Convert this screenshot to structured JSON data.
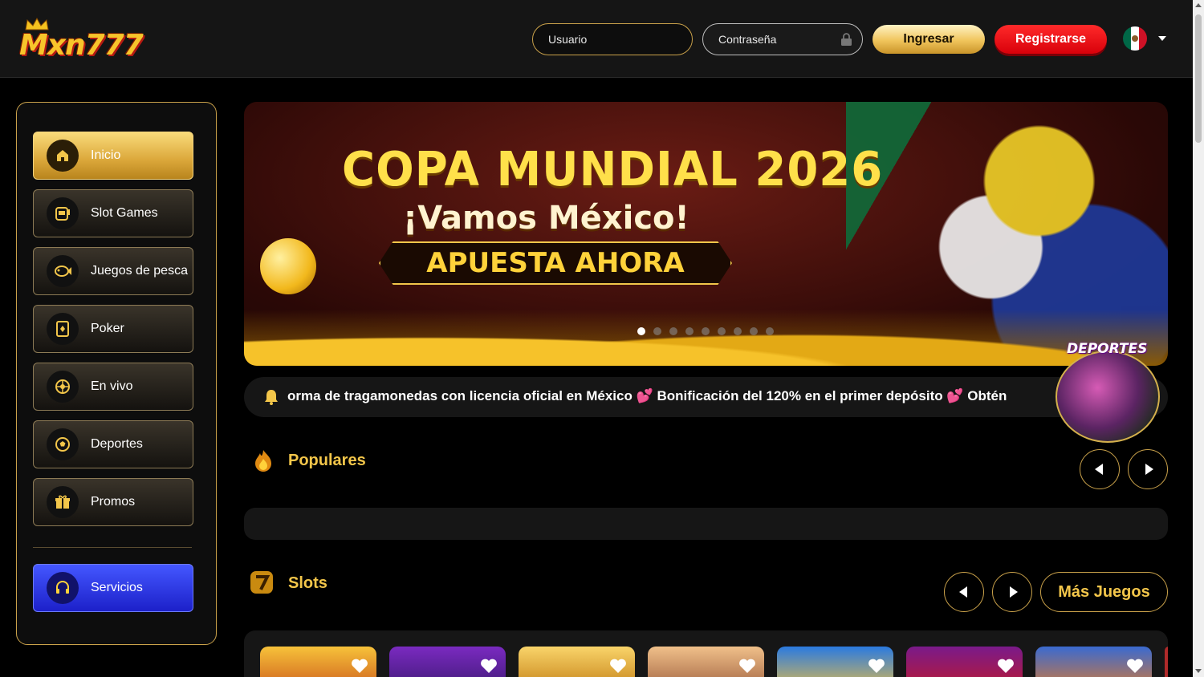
{
  "header": {
    "logo_text": "Mxn777",
    "username_placeholder": "Usuario",
    "password_placeholder": "Contraseña",
    "login_label": "Ingresar",
    "register_label": "Registrarse",
    "language": "mexico-flag-icon"
  },
  "sidebar": {
    "items": [
      {
        "label": "Inicio",
        "icon": "home-icon",
        "active": true
      },
      {
        "label": "Slot Games",
        "icon": "slot-machine-icon"
      },
      {
        "label": "Juegos de pesca",
        "icon": "fish-icon"
      },
      {
        "label": "Poker",
        "icon": "cards-icon"
      },
      {
        "label": "En vivo",
        "icon": "roulette-icon"
      },
      {
        "label": "Deportes",
        "icon": "soccer-ball-icon"
      },
      {
        "label": "Promos",
        "icon": "gift-icon"
      }
    ],
    "service": {
      "label": "Servicios",
      "icon": "headset-icon"
    }
  },
  "banner": {
    "title": "COPA MUNDIAL 2026",
    "subtitle": "¡Vamos México!",
    "cta": "APUESTA AHORA",
    "slide_count": 9,
    "active_slide": 1
  },
  "marquee": {
    "text": "orma de tragamonedas con licencia oficial en México 💕 Bonificación del 120% en el primer depósito 💕 Obtén"
  },
  "float": {
    "label": "DEPORTES"
  },
  "sections": {
    "popular_title": "Populares",
    "slots_title": "Slots",
    "more_games": "Más Juegos"
  },
  "colors": {
    "accent_gold": "#f3c64a",
    "register_red": "#e8000d",
    "service_blue": "#2f3ce6"
  }
}
